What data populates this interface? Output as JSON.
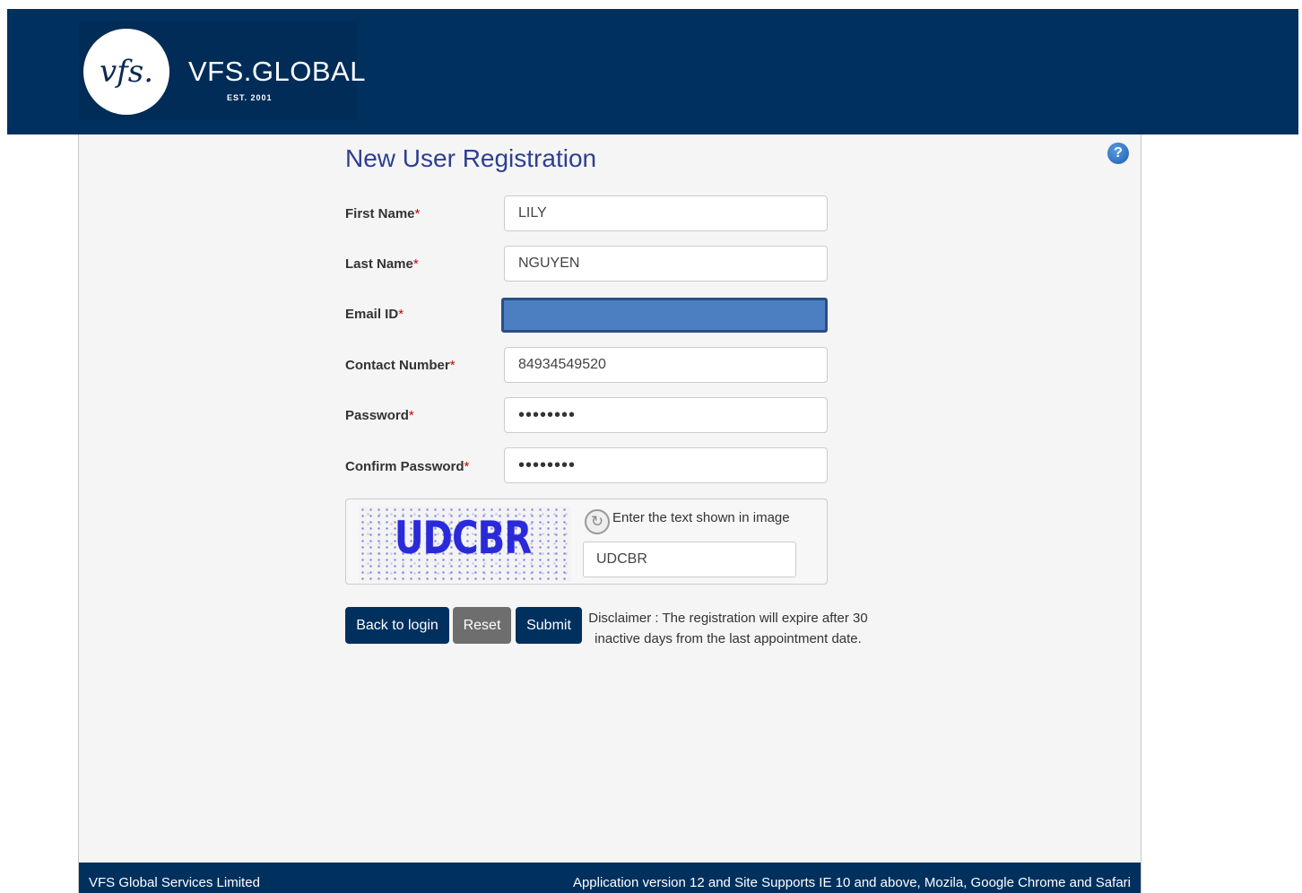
{
  "header": {
    "logo_mark": "vfs.",
    "logo_name": "VFS.GLOBAL",
    "logo_est": "EST. 2001"
  },
  "form": {
    "title": "New User Registration",
    "help_icon_glyph": "?",
    "required_marker": "*",
    "fields": {
      "first_name": {
        "label": "First Name",
        "value": "LILY"
      },
      "last_name": {
        "label": "Last Name",
        "value": "NGUYEN"
      },
      "email": {
        "label": "Email ID",
        "value": ""
      },
      "contact": {
        "label": "Contact Number",
        "value": "84934549520"
      },
      "password": {
        "label": "Password",
        "value": "••••••••"
      },
      "confirm_password": {
        "label": "Confirm Password",
        "value": "••••••••"
      }
    },
    "captcha": {
      "image_text": "UDCBR",
      "prompt": "Enter the text shown in image",
      "value": "UDCBR",
      "refresh_icon": "refresh-icon"
    },
    "buttons": {
      "back": "Back to login",
      "reset": "Reset",
      "submit": "Submit"
    },
    "disclaimer": "Disclaimer : The registration will expire after 30 inactive days from the last appointment date."
  },
  "footer": {
    "left": "VFS Global Services Limited",
    "right": "Application version 12 and Site Supports IE 10 and above, Mozila, Google Chrome and Safari"
  },
  "colors": {
    "brand_navy": "#00305e",
    "title_blue": "#2d3f92",
    "required_red": "#cc0000",
    "reset_gray": "#6e6e6e",
    "email_highlight": "#4c7fc2"
  }
}
